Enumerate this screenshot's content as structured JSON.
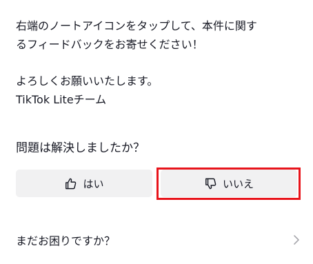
{
  "message": {
    "line1": "右端のノートアイコンをタップして、本件に関す",
    "line2": "るフィードバックをお寄せください！",
    "line3": "よろしくお願いいたします。",
    "line4": "TikTok Liteチーム"
  },
  "feedback": {
    "question": "問題は解決しましたか？",
    "yes_label": "はい",
    "no_label": "いいえ",
    "yes_icon": "thumbs-up-icon",
    "no_icon": "thumbs-down-icon",
    "highlight_color": "#e8141b"
  },
  "help": {
    "label": "まだお困りですか？",
    "icon": "chevron-right-icon"
  }
}
